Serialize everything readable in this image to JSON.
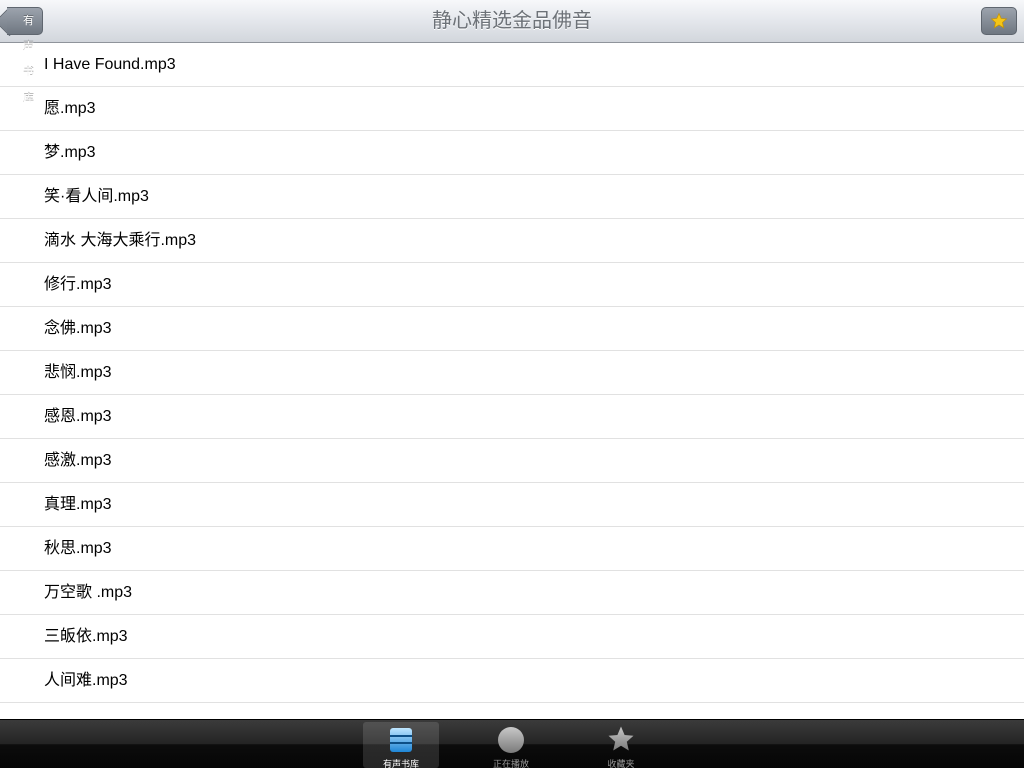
{
  "navbar": {
    "back_label": "有声书库",
    "title": "静心精选金品佛音",
    "star_icon": "star-icon"
  },
  "tracks": [
    "I Have Found.mp3",
    "愿.mp3",
    "梦.mp3",
    "笑·看人间.mp3",
    "滴水 大海大乘行.mp3",
    "修行.mp3",
    "念佛.mp3",
    "悲悯.mp3",
    "感恩.mp3",
    "感激.mp3",
    "真理.mp3",
    "秋思.mp3",
    "万空歌 .mp3",
    "三皈依.mp3",
    "人间难.mp3"
  ],
  "tabbar": {
    "tabs": [
      {
        "label": "有声书库",
        "icon": "library-icon",
        "selected": true
      },
      {
        "label": "正在播放",
        "icon": "now-playing-icon",
        "selected": false
      },
      {
        "label": "收藏夹",
        "icon": "star-icon",
        "selected": false
      }
    ]
  },
  "colors": {
    "accent_star": "#f5c518",
    "navbar_title": "#6d7278"
  }
}
